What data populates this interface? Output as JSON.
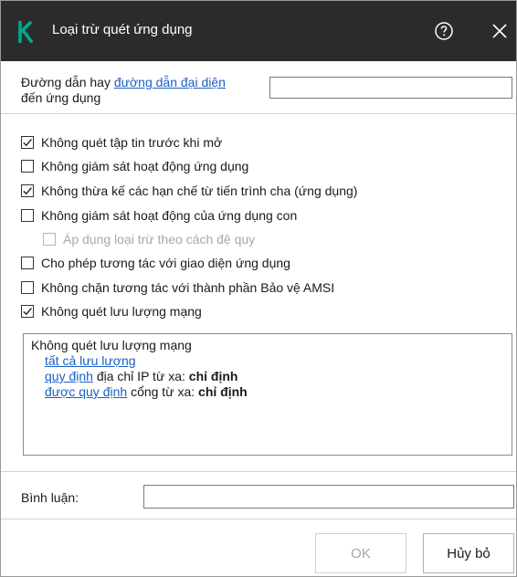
{
  "window": {
    "title": "Loại trừ quét ứng dụng",
    "logo_letter": "K",
    "brand_color": "#00a88e",
    "titlebar_color": "#2b2b2b"
  },
  "path": {
    "label_prefix": "Đường dẫn hay",
    "label_link": "đường dẫn đại diện",
    "label_suffix": "đến ứng dụng",
    "value": ""
  },
  "options": [
    {
      "label": "Không quét tập tin trước khi mở",
      "checked": true
    },
    {
      "label": "Không giám sát hoạt động ứng dụng",
      "checked": false
    },
    {
      "label": "Không thừa kế các hạn chế từ tiến trình cha (ứng dụng)",
      "checked": true
    },
    {
      "label": "Không giám sát hoạt động của ứng dụng con",
      "checked": false
    },
    {
      "label": "Áp dụng loại trừ theo cách đệ quy",
      "checked": false,
      "disabled": true
    },
    {
      "label": "Cho phép tương tác với giao diện ứng dụng",
      "checked": false
    },
    {
      "label": "Không chặn tương tác với thành phần Bảo vệ AMSI",
      "checked": false
    },
    {
      "label": "Không quét lưu lượng mạng",
      "checked": true
    }
  ],
  "traffic": {
    "title": "Không quét lưu lượng mạng",
    "all_traffic_link": "tất cả lưu lượng",
    "rule1_link": "quy định",
    "rule1_text": "địa chỉ IP từ xa:",
    "rule1_value_link": "chỉ định",
    "rule2_link": "được quy định",
    "rule2_text": "cổng từ xa:",
    "rule2_value_link": "chỉ định"
  },
  "comment": {
    "label": "Bình luận:",
    "value": ""
  },
  "buttons": {
    "ok": "OK",
    "cancel": "Hủy bỏ"
  }
}
